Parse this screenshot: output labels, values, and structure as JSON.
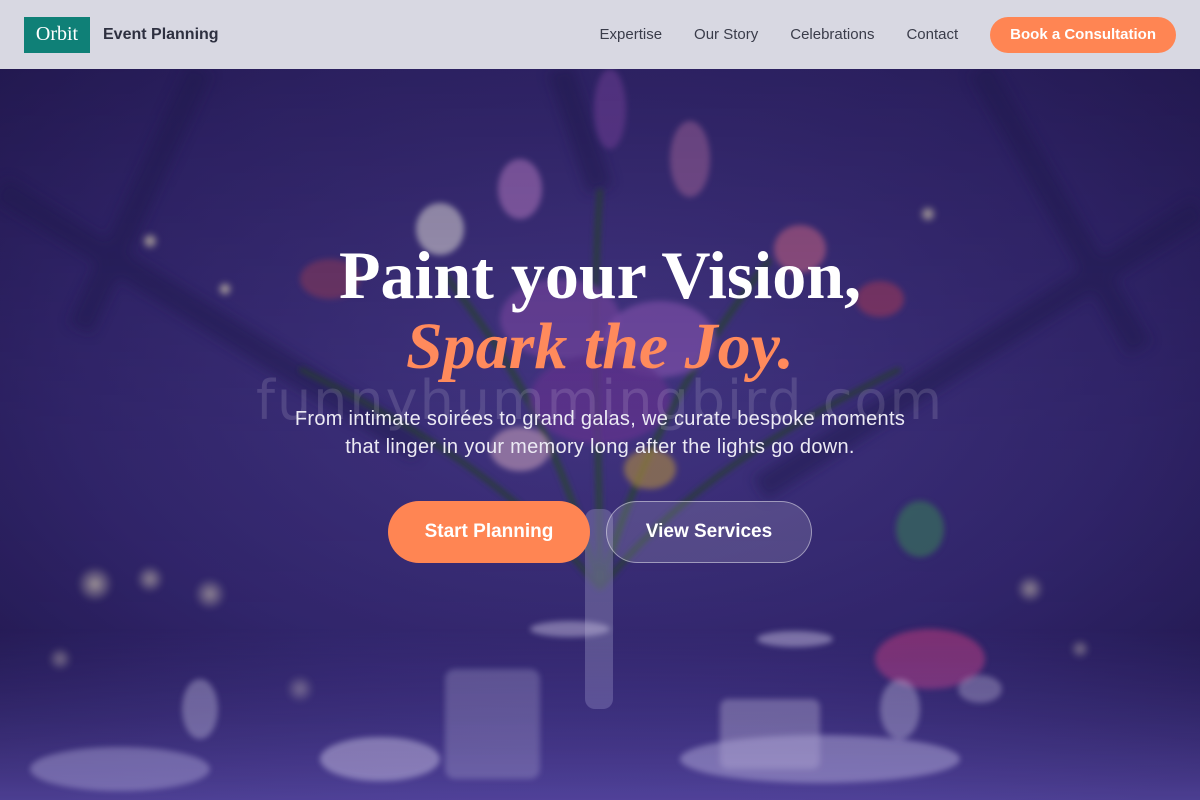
{
  "header": {
    "logo_text": "Orbit",
    "brand_name": "Event Planning",
    "nav": [
      {
        "label": "Expertise"
      },
      {
        "label": "Our Story"
      },
      {
        "label": "Celebrations"
      },
      {
        "label": "Contact"
      }
    ],
    "cta_label": "Book a Consultation"
  },
  "hero": {
    "headline_line1": "Paint your Vision,",
    "headline_line2": "Spark the Joy.",
    "watermark": "funnyhummingbird.com",
    "subtext_line1": "From intimate soirées to grand galas, we curate bespoke moments",
    "subtext_line2": "that linger in your memory long after the lights go down.",
    "primary_button": "Start Planning",
    "secondary_button": "View Services"
  },
  "colors": {
    "brand_teal": "#0f8077",
    "accent_orange": "#ff8553",
    "header_bg": "#d8d8e2",
    "hero_purple": "#3a2d7a"
  }
}
